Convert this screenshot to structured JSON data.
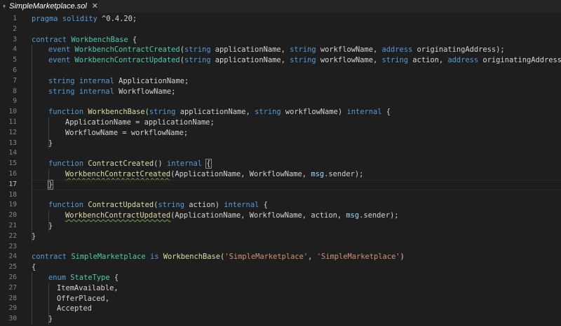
{
  "tab": {
    "title": "SimpleMarketplace.sol",
    "close_glyph": "✕",
    "icon": "solidity-diamond-icon"
  },
  "colors": {
    "background": "#1e1e1e",
    "keyword": "#569cd6",
    "type": "#4ec9b0",
    "function": "#dcdcaa",
    "string": "#ce9178",
    "line_number": "#858585"
  },
  "editor": {
    "current_line": 17,
    "lines": [
      {
        "n": "1",
        "i": 0,
        "t": [
          [
            "k",
            "pragma"
          ],
          [
            "p",
            " "
          ],
          [
            "k",
            "solidity"
          ],
          [
            "p",
            " ^0.4.20;"
          ]
        ]
      },
      {
        "n": "2",
        "i": 0,
        "t": []
      },
      {
        "n": "3",
        "i": 0,
        "t": [
          [
            "k",
            "contract"
          ],
          [
            "p",
            " "
          ],
          [
            "t",
            "WorkbenchBase"
          ],
          [
            "p",
            " {"
          ]
        ]
      },
      {
        "n": "4",
        "i": 1,
        "t": [
          [
            "k",
            "event"
          ],
          [
            "p",
            " "
          ],
          [
            "t",
            "WorkbenchContractCreated"
          ],
          [
            "p",
            "("
          ],
          [
            "k",
            "string"
          ],
          [
            "p",
            " applicationName, "
          ],
          [
            "k",
            "string"
          ],
          [
            "p",
            " workflowName, "
          ],
          [
            "k",
            "address"
          ],
          [
            "p",
            " originatingAddress);"
          ]
        ]
      },
      {
        "n": "5",
        "i": 1,
        "t": [
          [
            "k",
            "event"
          ],
          [
            "p",
            " "
          ],
          [
            "t",
            "WorkbenchContractUpdated"
          ],
          [
            "p",
            "("
          ],
          [
            "k",
            "string"
          ],
          [
            "p",
            " applicationName, "
          ],
          [
            "k",
            "string"
          ],
          [
            "p",
            " workflowName, "
          ],
          [
            "k",
            "string"
          ],
          [
            "p",
            " action, "
          ],
          [
            "k",
            "address"
          ],
          [
            "p",
            " originatingAddress);"
          ]
        ]
      },
      {
        "n": "6",
        "i": 0,
        "t": []
      },
      {
        "n": "7",
        "i": 1,
        "t": [
          [
            "k",
            "string"
          ],
          [
            "p",
            " "
          ],
          [
            "k",
            "internal"
          ],
          [
            "p",
            " ApplicationName;"
          ]
        ]
      },
      {
        "n": "8",
        "i": 1,
        "t": [
          [
            "k",
            "string"
          ],
          [
            "p",
            " "
          ],
          [
            "k",
            "internal"
          ],
          [
            "p",
            " WorkflowName;"
          ]
        ]
      },
      {
        "n": "9",
        "i": 0,
        "t": []
      },
      {
        "n": "10",
        "i": 1,
        "t": [
          [
            "k",
            "function"
          ],
          [
            "p",
            " "
          ],
          [
            "f",
            "WorkbenchBase"
          ],
          [
            "p",
            "("
          ],
          [
            "k",
            "string"
          ],
          [
            "p",
            " applicationName, "
          ],
          [
            "k",
            "string"
          ],
          [
            "p",
            " workflowName) "
          ],
          [
            "k",
            "internal"
          ],
          [
            "p",
            " {"
          ]
        ]
      },
      {
        "n": "11",
        "i": 2,
        "t": [
          [
            "p",
            "ApplicationName = applicationName;"
          ]
        ]
      },
      {
        "n": "12",
        "i": 2,
        "t": [
          [
            "p",
            "WorkflowName = workflowName;"
          ]
        ]
      },
      {
        "n": "13",
        "i": 1,
        "t": [
          [
            "p",
            "}"
          ]
        ]
      },
      {
        "n": "14",
        "i": 0,
        "t": []
      },
      {
        "n": "15",
        "i": 1,
        "t": [
          [
            "k",
            "function"
          ],
          [
            "p",
            " "
          ],
          [
            "f",
            "ContractCreated"
          ],
          [
            "p",
            "() "
          ],
          [
            "k",
            "internal"
          ],
          [
            "p",
            " "
          ],
          [
            "bm",
            "{"
          ]
        ]
      },
      {
        "n": "16",
        "i": 2,
        "t": [
          [
            "fs",
            "WorkbenchContractCreated"
          ],
          [
            "p",
            "(ApplicationName, WorkflowName, "
          ],
          [
            "v",
            "msg"
          ],
          [
            "p",
            ".sender);"
          ]
        ]
      },
      {
        "n": "17",
        "i": 1,
        "t": [
          [
            "bm",
            "}"
          ]
        ]
      },
      {
        "n": "18",
        "i": 0,
        "t": []
      },
      {
        "n": "19",
        "i": 1,
        "t": [
          [
            "k",
            "function"
          ],
          [
            "p",
            " "
          ],
          [
            "f",
            "ContractUpdated"
          ],
          [
            "p",
            "("
          ],
          [
            "k",
            "string"
          ],
          [
            "p",
            " action) "
          ],
          [
            "k",
            "internal"
          ],
          [
            "p",
            " {"
          ]
        ]
      },
      {
        "n": "20",
        "i": 2,
        "t": [
          [
            "fs",
            "WorkbenchContractUpdated"
          ],
          [
            "p",
            "(ApplicationName, WorkflowName, action, "
          ],
          [
            "v",
            "msg"
          ],
          [
            "p",
            ".sender);"
          ]
        ]
      },
      {
        "n": "21",
        "i": 1,
        "t": [
          [
            "p",
            "}"
          ]
        ]
      },
      {
        "n": "22",
        "i": 0,
        "t": [
          [
            "p",
            "}"
          ]
        ]
      },
      {
        "n": "23",
        "i": 0,
        "t": []
      },
      {
        "n": "24",
        "i": 0,
        "t": [
          [
            "k",
            "contract"
          ],
          [
            "p",
            " "
          ],
          [
            "t",
            "SimpleMarketplace"
          ],
          [
            "p",
            " "
          ],
          [
            "k",
            "is"
          ],
          [
            "p",
            " "
          ],
          [
            "f",
            "WorkbenchBase"
          ],
          [
            "p",
            "("
          ],
          [
            "s",
            "'SimpleMarketplace'"
          ],
          [
            "p",
            ", "
          ],
          [
            "s",
            "'SimpleMarketplace'"
          ],
          [
            "p",
            ")"
          ]
        ]
      },
      {
        "n": "25",
        "i": 0,
        "t": [
          [
            "p",
            "{"
          ]
        ]
      },
      {
        "n": "26",
        "i": 1,
        "t": [
          [
            "k",
            "enum"
          ],
          [
            "p",
            " "
          ],
          [
            "t",
            "StateType"
          ],
          [
            "p",
            " {"
          ]
        ]
      },
      {
        "n": "27",
        "i": 1.5,
        "t": [
          [
            "p",
            "ItemAvailable,"
          ]
        ]
      },
      {
        "n": "28",
        "i": 1.5,
        "t": [
          [
            "p",
            "OfferPlaced,"
          ]
        ]
      },
      {
        "n": "29",
        "i": 1.5,
        "t": [
          [
            "p",
            "Accepted"
          ]
        ]
      },
      {
        "n": "30",
        "i": 1,
        "t": [
          [
            "p",
            "}"
          ]
        ]
      }
    ]
  }
}
